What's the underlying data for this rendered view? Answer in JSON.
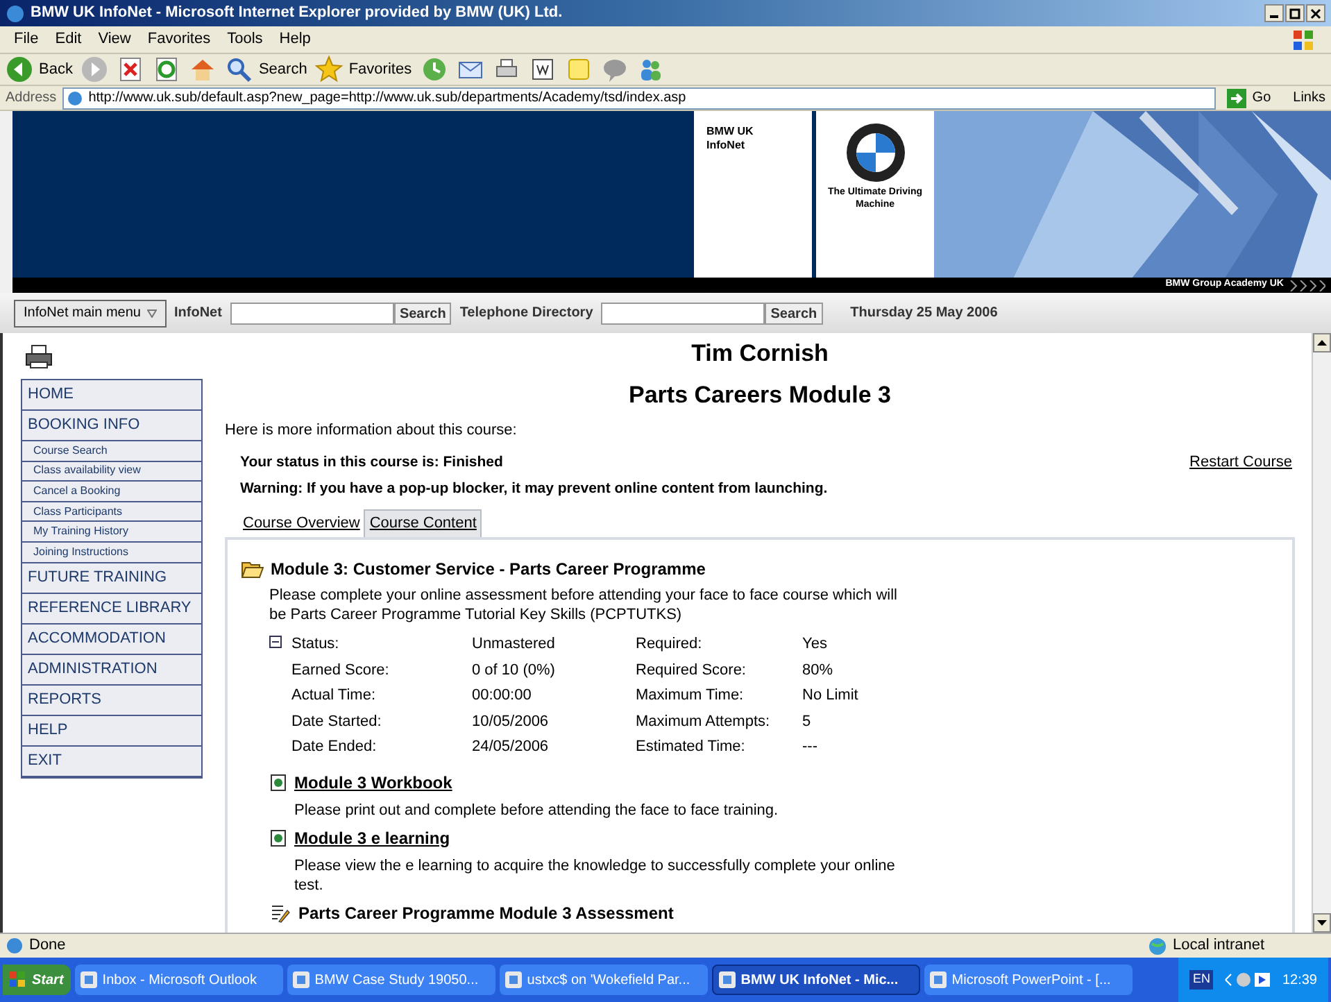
{
  "window": {
    "title": "BMW UK InfoNet - Microsoft Internet Explorer provided by BMW (UK) Ltd."
  },
  "menu": [
    "File",
    "Edit",
    "View",
    "Favorites",
    "Tools",
    "Help"
  ],
  "toolbar": [
    {
      "kind": "back",
      "label": "Back"
    },
    {
      "kind": "forward"
    },
    {
      "kind": "stop"
    },
    {
      "kind": "refresh"
    },
    {
      "kind": "home"
    },
    {
      "kind": "search",
      "label": "Search"
    },
    {
      "kind": "favorites",
      "label": "Favorites"
    },
    {
      "kind": "history"
    },
    {
      "kind": "mail"
    },
    {
      "kind": "print"
    },
    {
      "kind": "edit"
    },
    {
      "kind": "note"
    },
    {
      "kind": "chat"
    },
    {
      "kind": "people"
    }
  ],
  "address": {
    "label": "Address",
    "value": "http://www.uk.sub/default.asp?new_page=http://www.uk.sub/departments/Academy/tsd/index.asp",
    "go": "Go",
    "links": "Links"
  },
  "banner": {
    "site_name": "BMW UK InfoNet",
    "tagline": "The Ultimate Driving Machine",
    "academy": "BMW Group Academy UK"
  },
  "navbar": {
    "menu_button": "InfoNet main menu",
    "infonet_label": "InfoNet",
    "search1": "Search",
    "directory_label": "Telephone Directory",
    "search2": "Search",
    "date": "Thursday 25 May 2006"
  },
  "sidebar": {
    "items": [
      {
        "kind": "main",
        "label": "HOME"
      },
      {
        "kind": "main",
        "label": "BOOKING INFO"
      },
      {
        "kind": "sub",
        "label": "Course Search"
      },
      {
        "kind": "sub",
        "label": "Class availability view"
      },
      {
        "kind": "sub",
        "label": "Cancel a Booking"
      },
      {
        "kind": "sub",
        "label": "Class Participants"
      },
      {
        "kind": "sub",
        "label": "My Training History"
      },
      {
        "kind": "sub",
        "label": "Joining Instructions"
      },
      {
        "kind": "main",
        "label": "FUTURE TRAINING"
      },
      {
        "kind": "main",
        "label": "REFERENCE LIBRARY"
      },
      {
        "kind": "main",
        "label": "ACCOMMODATION"
      },
      {
        "kind": "main",
        "label": "ADMINISTRATION"
      },
      {
        "kind": "main",
        "label": "REPORTS"
      },
      {
        "kind": "main",
        "label": "HELP"
      },
      {
        "kind": "main",
        "label": "EXIT"
      }
    ]
  },
  "page": {
    "user_name": "Tim Cornish",
    "course_title": "Parts Careers Module 3",
    "intro": "Here is more information about this course:",
    "status": "Your status in this course is: Finished",
    "warning": "Warning: If you have a pop-up blocker, it may prevent online content from launching.",
    "restart": "Restart Course",
    "tabs": [
      {
        "label": "Course Overview",
        "selected": false
      },
      {
        "label": "Course Content",
        "selected": true
      }
    ],
    "module": {
      "title": "Module 3: Customer Service - Parts Career Programme",
      "description": "Please complete your online assessment before attending your face to face course which will be Parts Career Programme Tutorial Key Skills (PCPTUTKS)",
      "expanded": true,
      "details": [
        {
          "label": "Status:",
          "value": "Unmastered",
          "label2": "Required:",
          "value2": "Yes"
        },
        {
          "label": "Earned Score:",
          "value": "0 of 10 (0%)",
          "label2": "Required Score:",
          "value2": "80%"
        },
        {
          "label": "Actual Time:",
          "value": "00:00:00",
          "label2": "Maximum Time:",
          "value2": "No Limit"
        },
        {
          "label": "Date Started:",
          "value": "10/05/2006",
          "label2": "Maximum Attempts:",
          "value2": "5"
        },
        {
          "label": "Date Ended:",
          "value": "24/05/2006",
          "label2": "Estimated Time:",
          "value2": "---"
        }
      ],
      "items": [
        {
          "kind": "document",
          "title": "Module 3 Workbook",
          "description": "Please print out and complete before attending the face to face training."
        },
        {
          "kind": "document",
          "title": "Module 3 e learning",
          "description": "Please view the e learning to acquire the knowledge to successfully complete your online test."
        },
        {
          "kind": "assessment",
          "title": "Parts Career Programme Module 3 Assessment"
        }
      ]
    }
  },
  "status_bar": {
    "text": "Done",
    "zone": "Local intranet"
  },
  "taskbar": {
    "start": "Start",
    "tasks": [
      {
        "label": "Inbox - Microsoft Outlook",
        "selected": false
      },
      {
        "label": "BMW Case Study 19050...",
        "selected": false
      },
      {
        "label": "ustxc$ on 'Wokefield Par...",
        "selected": false
      },
      {
        "label": "BMW UK InfoNet - Mic...",
        "selected": true
      },
      {
        "label": "Microsoft PowerPoint - [...",
        "selected": false
      }
    ],
    "language": "EN",
    "time": "12:39"
  }
}
